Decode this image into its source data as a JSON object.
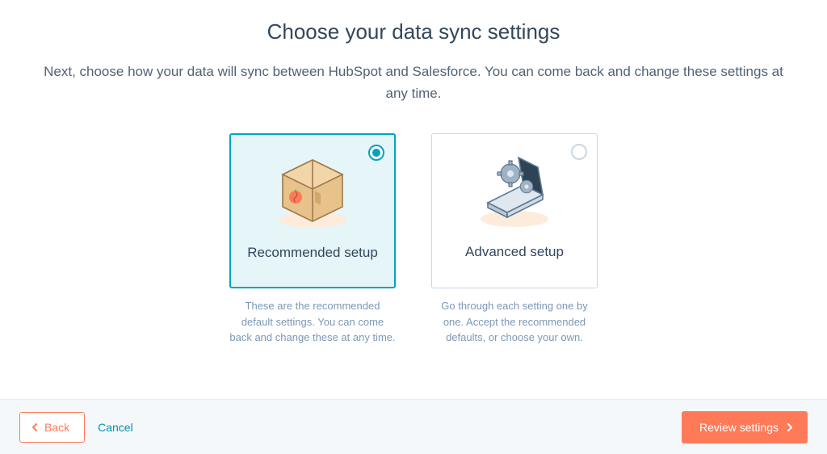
{
  "page": {
    "title": "Choose your data sync settings",
    "subtitle": "Next, choose how your data will sync between HubSpot and Salesforce. You can come back and change these settings at any time."
  },
  "options": {
    "recommended": {
      "title": "Recommended setup",
      "desc": "These are the recommended default settings. You can come back and change these at any time.",
      "selected": true
    },
    "advanced": {
      "title": "Advanced setup",
      "desc": "Go through each setting one by one. Accept the recommended defaults, or choose your own.",
      "selected": false
    }
  },
  "footer": {
    "back_label": "Back",
    "cancel_label": "Cancel",
    "primary_label": "Review settings"
  },
  "colors": {
    "accent_teal": "#00a4bd",
    "accent_orange": "#ff7a59",
    "text_heading": "#33475b",
    "text_muted": "#7c98b6",
    "card_selected_bg": "#e5f5f8"
  }
}
